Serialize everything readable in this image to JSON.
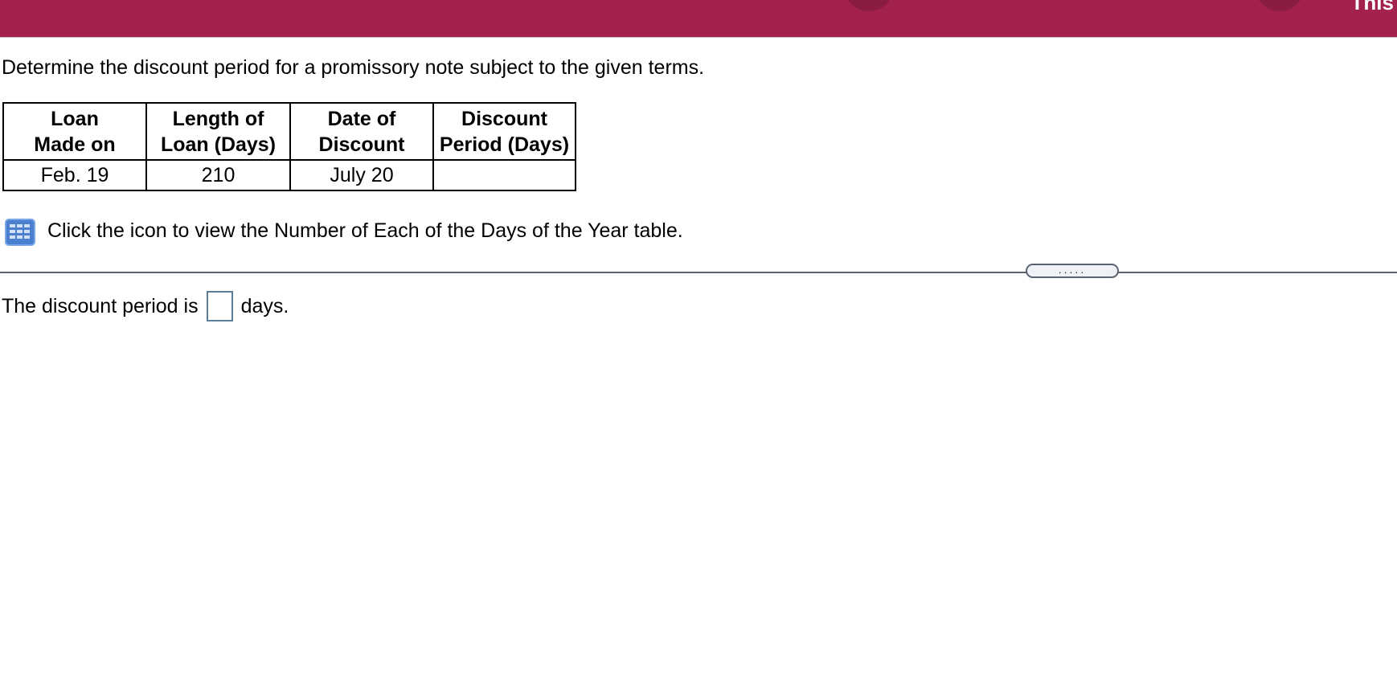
{
  "header": {
    "text": "This",
    "background_color": "#a3224c"
  },
  "question": {
    "instruction": "Determine the discount period for a promissory note subject to the given terms."
  },
  "terms_table": {
    "headers": [
      [
        "Loan",
        "Made on"
      ],
      [
        "Length of",
        "Loan (Days)"
      ],
      [
        "Date of",
        "Discount"
      ],
      [
        "Discount",
        "Period (Days)"
      ]
    ],
    "rows": [
      [
        "Feb. 19",
        "210",
        "July 20",
        ""
      ]
    ]
  },
  "reference": {
    "icon": "table-grid-icon",
    "text": "Click the icon to view the Number of Each of the Days of the Year table."
  },
  "divider": {
    "handle_label": "....."
  },
  "answer": {
    "prefix": "The discount period is",
    "value": "",
    "suffix": "days."
  }
}
